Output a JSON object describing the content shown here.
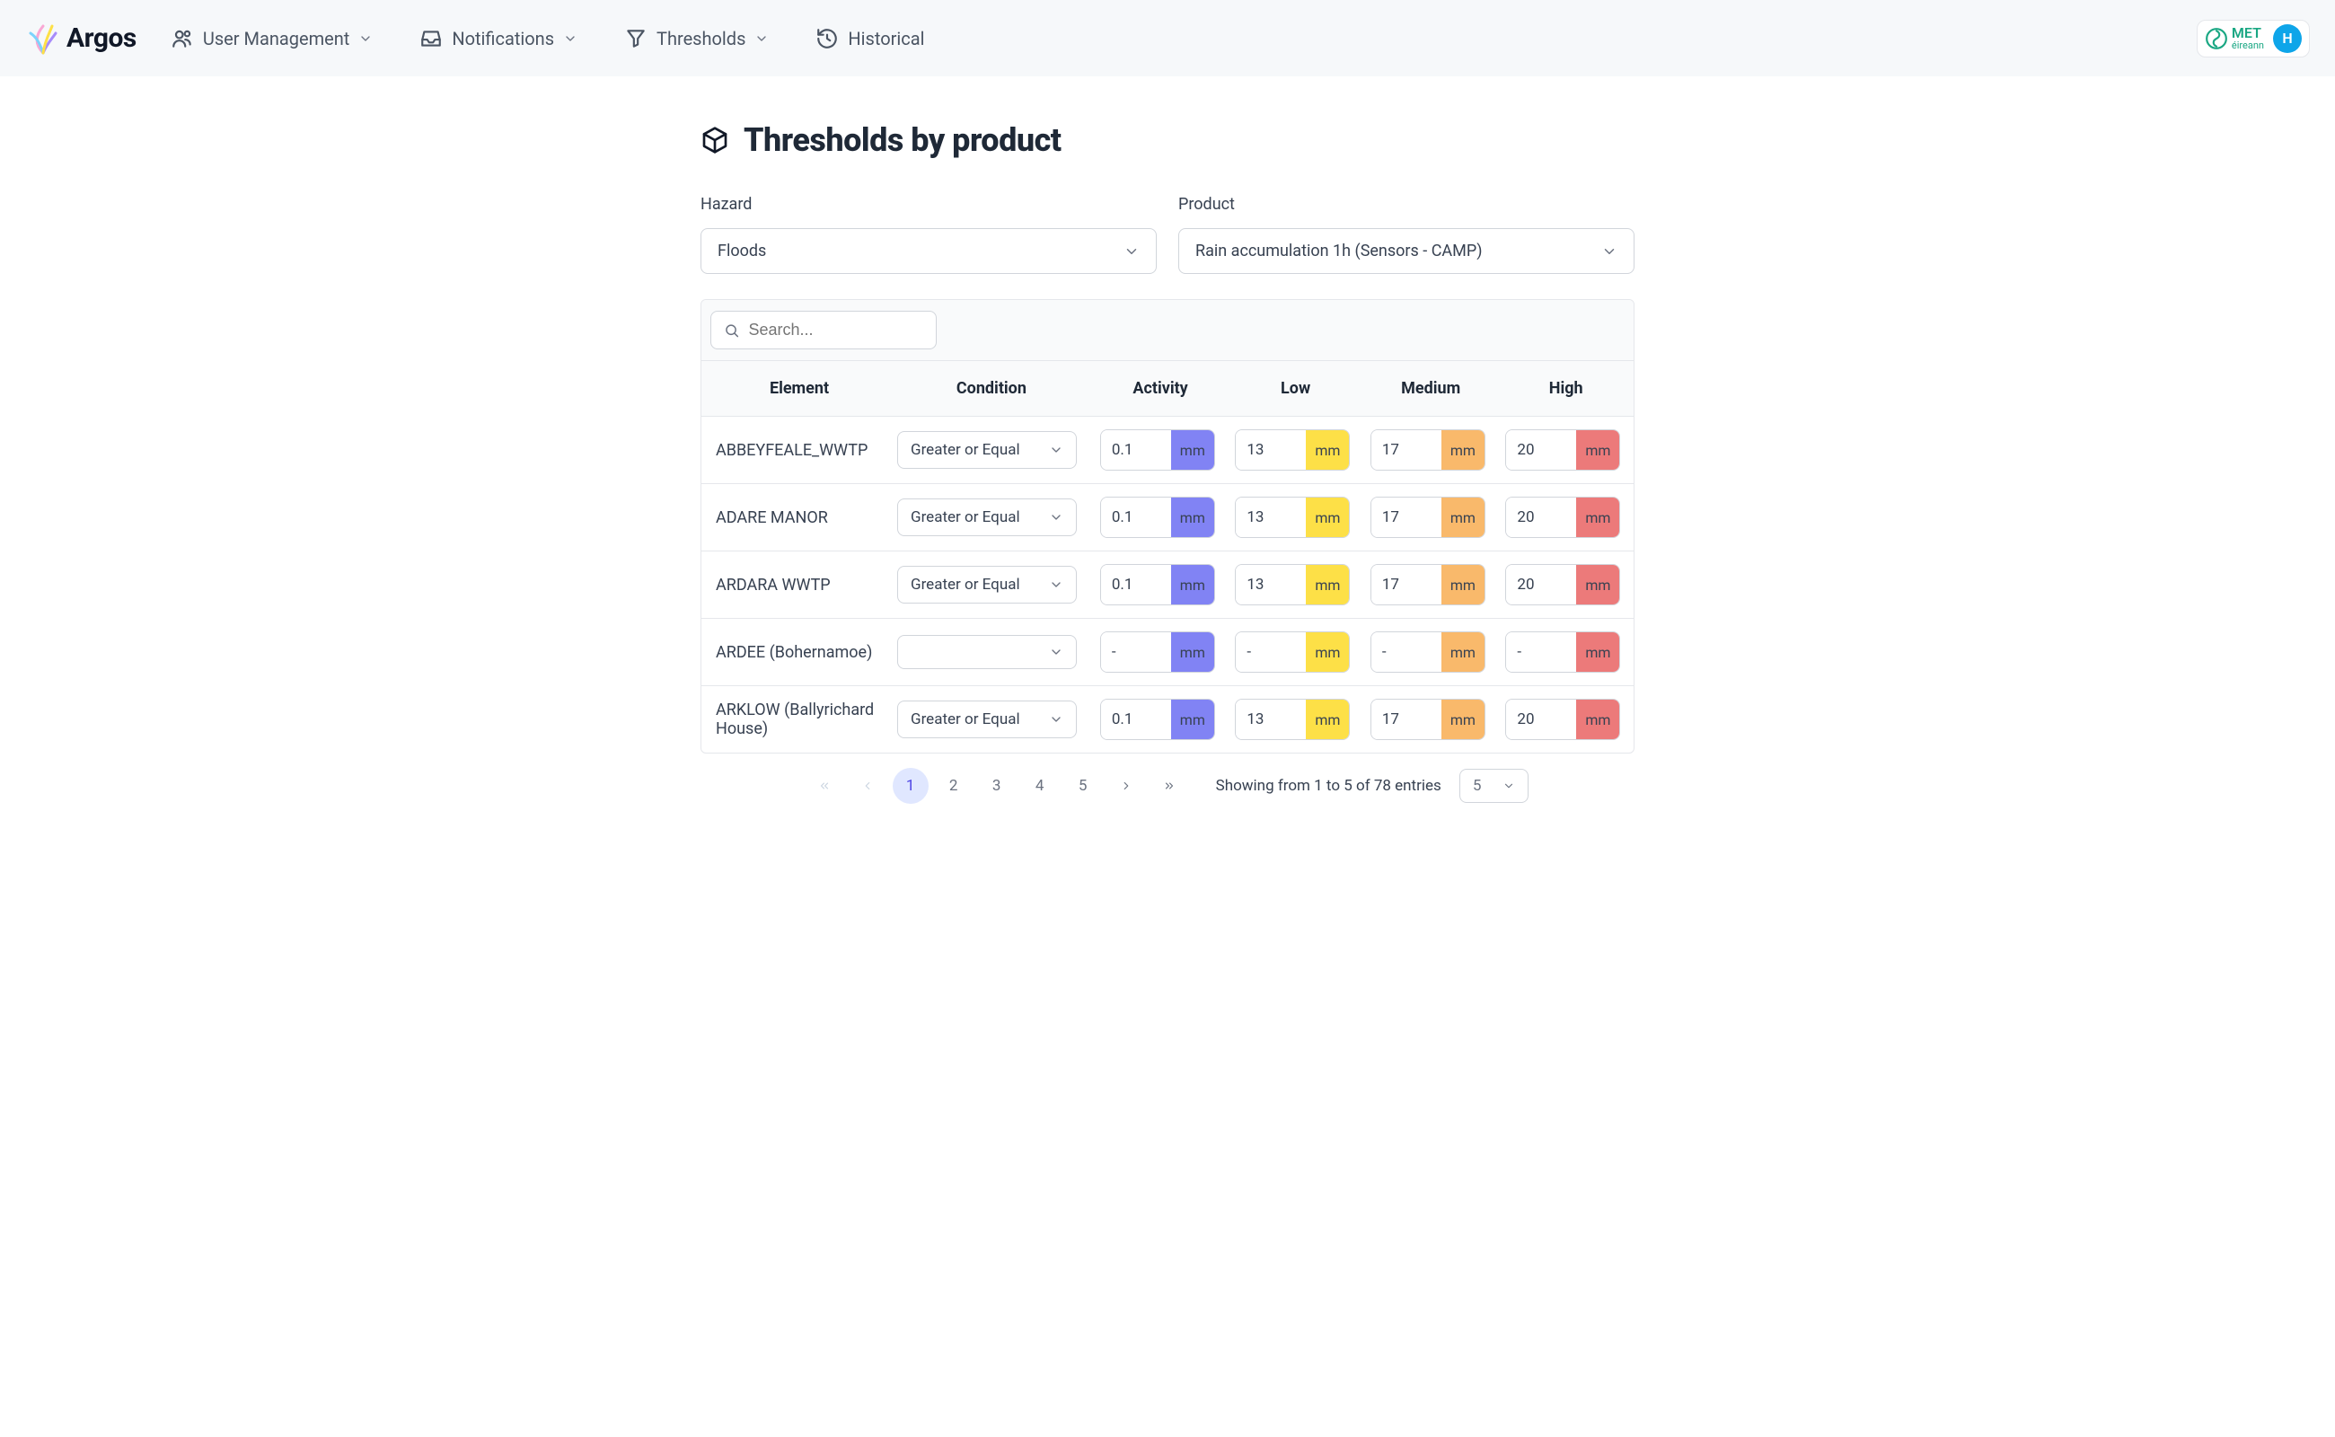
{
  "brand": {
    "name": "Argos"
  },
  "nav": {
    "user_management": "User Management",
    "notifications": "Notifications",
    "thresholds": "Thresholds",
    "historical": "Historical"
  },
  "topbar_right": {
    "partner": "MET",
    "partner_sub": "éireann",
    "avatar_initial": "H"
  },
  "page": {
    "title": "Thresholds by product"
  },
  "filters": {
    "hazard": {
      "label": "Hazard",
      "value": "Floods"
    },
    "product": {
      "label": "Product",
      "value": "Rain accumulation 1h (Sensors - CAMP)"
    }
  },
  "search": {
    "placeholder": "Search..."
  },
  "table": {
    "headers": {
      "element": "Element",
      "condition": "Condition",
      "activity": "Activity",
      "low": "Low",
      "medium": "Medium",
      "high": "High"
    },
    "unit": "mm",
    "rows": [
      {
        "element": "ABBEYFEALE_WWTP",
        "condition": "Greater or Equal",
        "activity": "0.1",
        "low": "13",
        "medium": "17",
        "high": "20"
      },
      {
        "element": "ADARE MANOR",
        "condition": "Greater or Equal",
        "activity": "0.1",
        "low": "13",
        "medium": "17",
        "high": "20"
      },
      {
        "element": "ARDARA WWTP",
        "condition": "Greater or Equal",
        "activity": "0.1",
        "low": "13",
        "medium": "17",
        "high": "20"
      },
      {
        "element": "ARDEE (Bohernamoe)",
        "condition": "",
        "activity": "-",
        "low": "-",
        "medium": "-",
        "high": "-"
      },
      {
        "element": "ARKLOW (Ballyrichard House)",
        "condition": "Greater or Equal",
        "activity": "0.1",
        "low": "13",
        "medium": "17",
        "high": "20"
      }
    ]
  },
  "pagination": {
    "pages": [
      "1",
      "2",
      "3",
      "4",
      "5"
    ],
    "active": "1",
    "status": "Showing from 1 to 5 of 78 entries",
    "page_size": "5"
  }
}
